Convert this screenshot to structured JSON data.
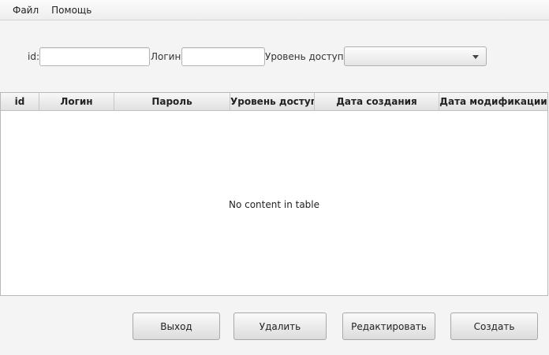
{
  "menu": {
    "items": [
      {
        "label": "Файл"
      },
      {
        "label": "Помощь"
      }
    ]
  },
  "filters": {
    "id_label": "id:",
    "id_value": "",
    "login_label": "Логин:",
    "login_value": "",
    "access_label": "Уровень доступа:",
    "access_value": ""
  },
  "table": {
    "columns": [
      "id",
      "Логин",
      "Пароль",
      "Уровень доступа",
      "Дата создания",
      "Дата модификации"
    ],
    "rows": [],
    "empty_text": "No content in table"
  },
  "buttons": {
    "exit": "Выход",
    "delete": "Удалить",
    "edit": "Редактировать",
    "create": "Создать"
  },
  "colors": {
    "background": "#f4f4f4",
    "table_background": "#ffffff",
    "border": "#b8b8b8"
  }
}
